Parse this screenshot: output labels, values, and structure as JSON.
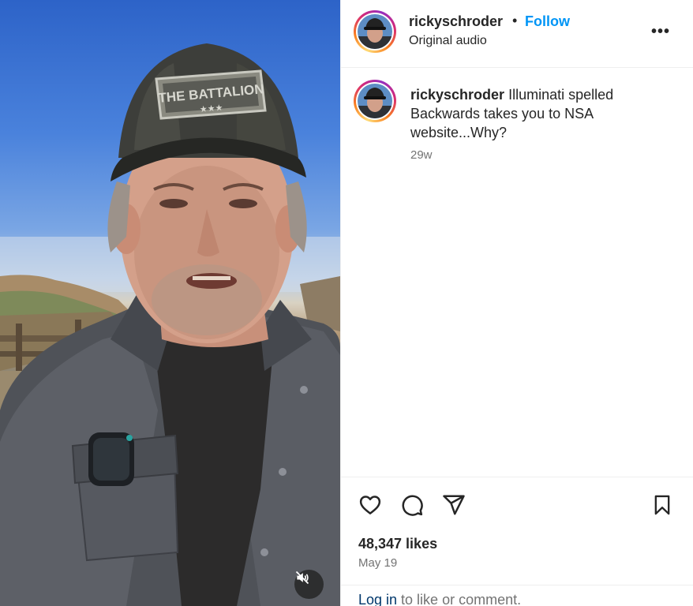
{
  "post": {
    "username": "rickyschroder",
    "dot": "•",
    "follow_label": "Follow",
    "audio_label": "Original audio",
    "more_label": "•••",
    "caption_username": "rickyschroder",
    "caption_text": " Illuminati spelled Backwards takes you to NSA website...Why?",
    "caption_age": "29w",
    "likes": "48,347 likes",
    "date": "May 19",
    "login_link": "Log in",
    "login_suffix": " to like or comment."
  },
  "media": {
    "cap_patch_text": "THE BATTALION",
    "video_muted": true
  },
  "icons": {
    "like": "heart-icon",
    "comment": "comment-icon",
    "share": "paper-plane-icon",
    "save": "bookmark-icon",
    "more": "more-options-icon",
    "mute": "speaker-muted-icon"
  },
  "colors": {
    "follow": "#0095f6",
    "text": "#262626",
    "secondary": "#737373",
    "link": "#00376b",
    "divider": "#efefef"
  }
}
